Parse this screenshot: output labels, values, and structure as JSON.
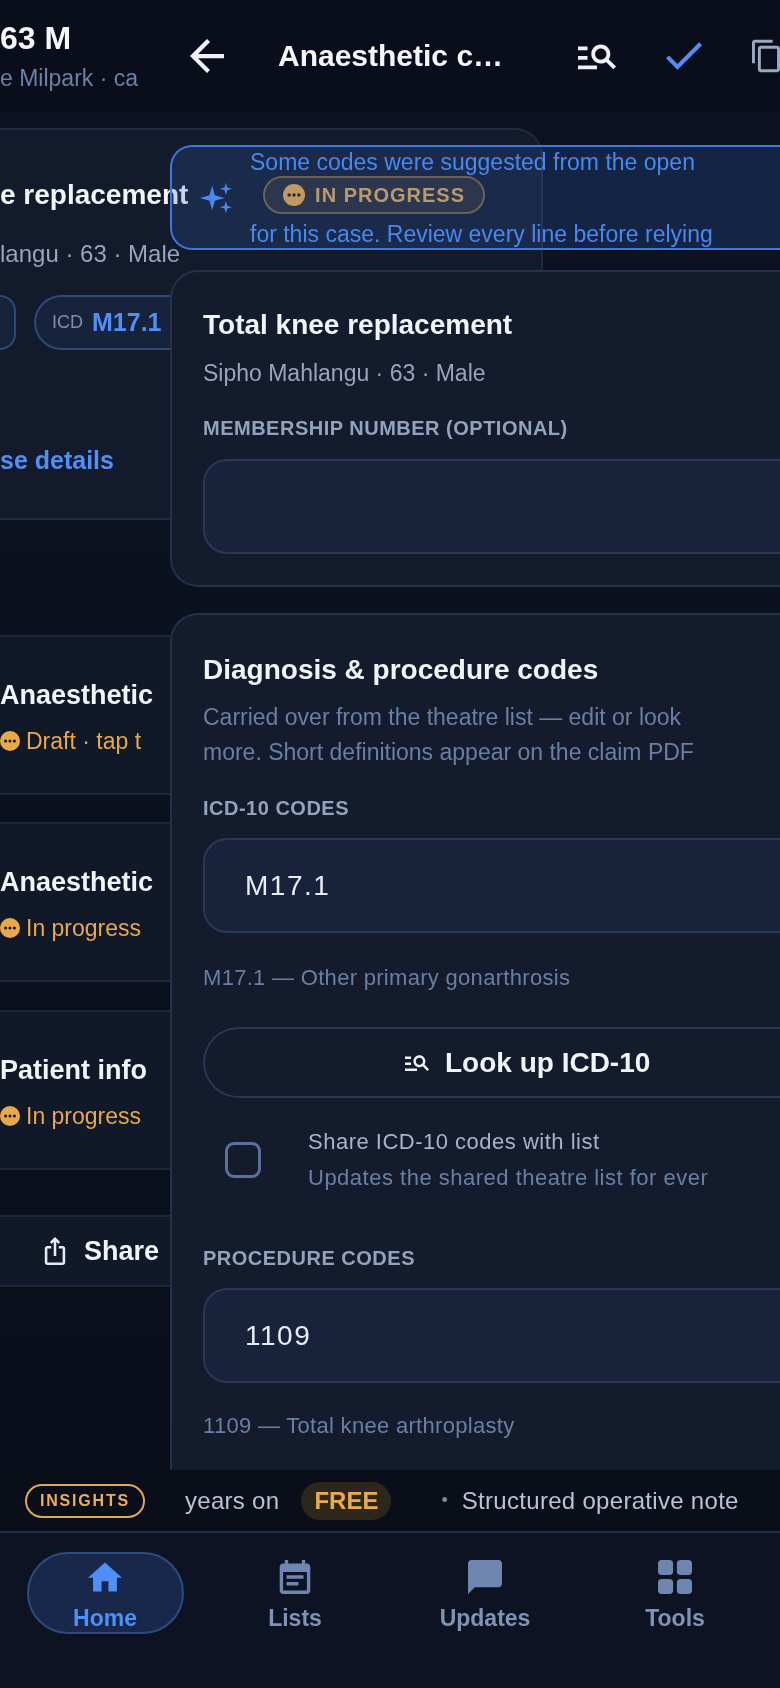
{
  "back_screen": {
    "header": {
      "title": "63 M",
      "subtitle": "e Milpark · ca"
    },
    "case_card": {
      "title": "e replacement",
      "badge": "IN PROGRESS",
      "subtitle": "langu · 63 · Male",
      "chips": [
        {
          "kind": "partial"
        },
        {
          "kind": "code",
          "label": "ICD",
          "value": "M17.1"
        }
      ],
      "link": "se details"
    },
    "forms": [
      {
        "title": "Anaesthetic",
        "status": "Draft · tap t"
      },
      {
        "title": "Anaesthetic",
        "status": "In progress"
      },
      {
        "title": "Patient info",
        "status": "In progress"
      }
    ],
    "share_button": "Share"
  },
  "front_screen": {
    "header": {
      "title": "Anaesthetic c…"
    },
    "notice": {
      "lines": [
        "Some codes were suggested from the open",
        "for this case. Review every line before relying"
      ]
    },
    "patient_card": {
      "title": "Total knee replacement",
      "subtitle": "Sipho Mahlangu · 63 · Male",
      "field": {
        "label": "MEMBERSHIP NUMBER (OPTIONAL)"
      }
    },
    "codes_card": {
      "title": "Diagnosis & procedure codes",
      "description": [
        "Carried over from the theatre list — edit or look",
        "more. Short definitions appear on the claim PDF"
      ],
      "groups": [
        {
          "label": "ICD-10 CODES",
          "value": "M17.1",
          "hint": "M17.1 — Other primary gonarthrosis",
          "lookup_button": "Look up ICD-10",
          "share_option": {
            "title": "Share ICD-10 codes with list",
            "description": "Updates the shared theatre list for ever",
            "checked": false
          }
        },
        {
          "label": "PROCEDURE CODES",
          "value": "1109",
          "hint": "1109 — Total knee arthroplasty"
        }
      ]
    }
  },
  "ticker": {
    "badge": "INSIGHTS",
    "segments": [
      {
        "kind": "text",
        "text": "years on"
      },
      {
        "kind": "tag",
        "text": "FREE"
      },
      {
        "kind": "separator",
        "text": "•"
      },
      {
        "kind": "text",
        "text": "Structured operative note"
      }
    ]
  },
  "nav": {
    "items": [
      {
        "label": "Home",
        "selected": true
      },
      {
        "label": "Lists",
        "selected": false
      },
      {
        "label": "Updates",
        "selected": false
      },
      {
        "label": "Tools",
        "selected": false
      }
    ]
  }
}
